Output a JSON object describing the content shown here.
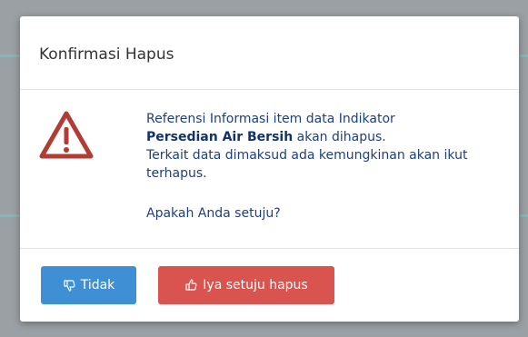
{
  "dialog": {
    "title": "Konfirmasi Hapus",
    "icon": "warning-triangle-icon",
    "message": {
      "line1": "Referensi Informasi item data Indikator",
      "item_name": "Persedian Air Bersih",
      "line2_suffix": " akan dihapus.",
      "line3": "Terkait data dimaksud ada kemungkinan akan ikut terhapus.",
      "question": "Apakah Anda setuju?"
    }
  },
  "buttons": {
    "cancel": {
      "label": "Tidak",
      "icon": "thumbs-down-icon",
      "color": "#3f8fd5"
    },
    "confirm": {
      "label": "Iya setuju hapus",
      "icon": "thumbs-up-icon",
      "color": "#d9534f"
    }
  },
  "colors": {
    "warning_icon": "#b23b33",
    "message_text": "#1f3f7a"
  }
}
